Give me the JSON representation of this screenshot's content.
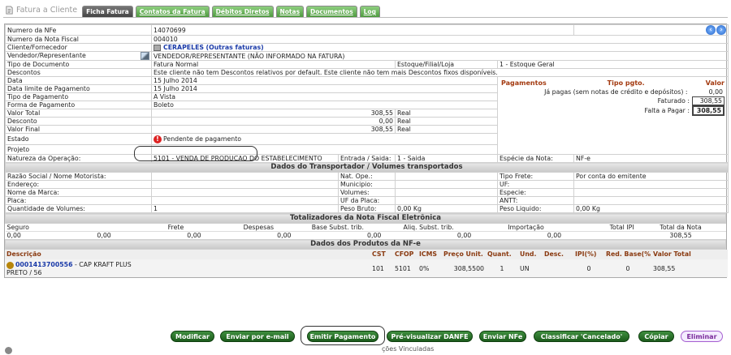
{
  "header": {
    "breadcrumb": "Fatura a Cliente",
    "tabs": [
      "Ficha Fatura",
      "Contatos da Fatura",
      "Débitos Diretos",
      "Notas",
      "Documentos",
      "Log"
    ]
  },
  "fields": {
    "numero_nfe_label": "Numero da NFe",
    "numero_nfe": "14070699",
    "numero_nf_label": "Numero da Nota Fiscal",
    "numero_nf": "004010",
    "cliente_label": "Cliente/Fornecedor",
    "cliente": "CERAPELES",
    "outras": "(Outras faturas)",
    "vendedor_label": "Vendedor/Representante",
    "vendedor": "VENDEDOR/REPRESENTANTE (NÃO INFORMADO NA FATURA)",
    "tipo_doc_label": "Tipo de Documento",
    "tipo_doc": "Fatura Normal",
    "estoque_label": "Estoque/Filial/Loja",
    "estoque": "1 - Estoque Geral",
    "descontos_label": "Descontos",
    "descontos": "Este cliente não tem Descontos relativos por default. Este cliente não tem mais Descontos fixos disponíveis.",
    "data_label": "Data",
    "data": "15 Julho 2014",
    "data_limite_label": "Data limite de Pagamento",
    "data_limite": "15 Julho 2014",
    "tipo_pag_label": "Tipo de Pagamento",
    "tipo_pag": "A Vista",
    "forma_pag_label": "Forma de Pagamento",
    "forma_pag": "Boleto",
    "valor_total_label": "Valor Total",
    "valor_total": "308,55",
    "real": "Real",
    "desconto_label": "Desconto",
    "desconto": "0,00",
    "valor_final_label": "Valor Final",
    "valor_final": "308,55",
    "estado_label": "Estado",
    "estado": "Pendente de pagamento",
    "projeto_label": "Projeto",
    "natureza_label": "Natureza da Operação:",
    "natureza": "5101 - VENDA DE PRODUCAO DO ESTABELECIMENTO",
    "entrada_label": "Entrada / Saida:",
    "entrada": "1 - Saida",
    "especie_label": "Espécie da Nota:",
    "especie": "NF-e"
  },
  "pgto": {
    "h1": "Pagamentos",
    "h2": "Tipo pgto.",
    "h3": "Valor",
    "ja_pagas": "Já pagas (sem notas de crédito e depósitos) :",
    "ja_pagas_val": "0,00",
    "faturado": "Faturado :",
    "faturado_val": "308,55",
    "falta": "Falta a Pagar :",
    "falta_val": "308,55"
  },
  "transp": {
    "title": "Dados do Transportador / Volumes transportados",
    "razao": "Razão Social / Nome Motorista:",
    "endereco": "Endereço:",
    "marca": "Nome da Marca:",
    "placa": "Placa:",
    "qtd": "Quantidade de Volumes:",
    "qtd_val": "1",
    "natope": "Nat. Ope.:",
    "municipio": "Municipio:",
    "volumes": "Volumes:",
    "ufplaca": "UF da Placa:",
    "peso_bruto": "Peso Bruto:",
    "peso_bruto_val": "0,00 Kg",
    "tipo_frete": "Tipo Frete:",
    "tipo_frete_val": "Por conta do emitente",
    "uf": "UF:",
    "especie": "Especie:",
    "antt": "ANTT:",
    "peso_liq": "Peso Liquido:",
    "peso_liq_val": "0,00 Kg"
  },
  "tot": {
    "title": "Totalizadores da Nota Fiscal Eletrônica",
    "labels": [
      "Seguro",
      "Frete",
      "Despesas",
      "Base Subst. trib.",
      "Aliq. Subst. trib.",
      "Importação",
      "Total IPI",
      "Total da Nota"
    ],
    "values": [
      "0,00",
      "0,00",
      "0,00",
      "0,00",
      "0,00",
      "0,00",
      "0,00",
      "308,55"
    ]
  },
  "prod": {
    "title": "Dados dos Produtos da NF-e",
    "headers": [
      "Descrição",
      "CST",
      "CFOP",
      "ICMS",
      "Preço Unit.",
      "Quant.",
      "Und.",
      "Desc.",
      "IPI(%)",
      "Red. Base(%)",
      "Valor Total"
    ],
    "code": "0001413700556",
    "name": "- CAP KRAFT PLUS",
    "sub": "PRETO / 56",
    "cst": "101",
    "cfop": "5101",
    "icms": "0%",
    "preco": "308,5500",
    "quant": "1",
    "und": "UN",
    "desc": "",
    "ipi": "0",
    "red": "0",
    "total": "308,55"
  },
  "buttons": [
    "Modificar",
    "Enviar por e-mail",
    "Emitir Pagamento",
    "Pré-visualizar DANFE",
    "Enviar NFe",
    "Classificar 'Cancelado'",
    "Cópiar",
    "Eliminar"
  ],
  "footer": "ções Vinculadas"
}
